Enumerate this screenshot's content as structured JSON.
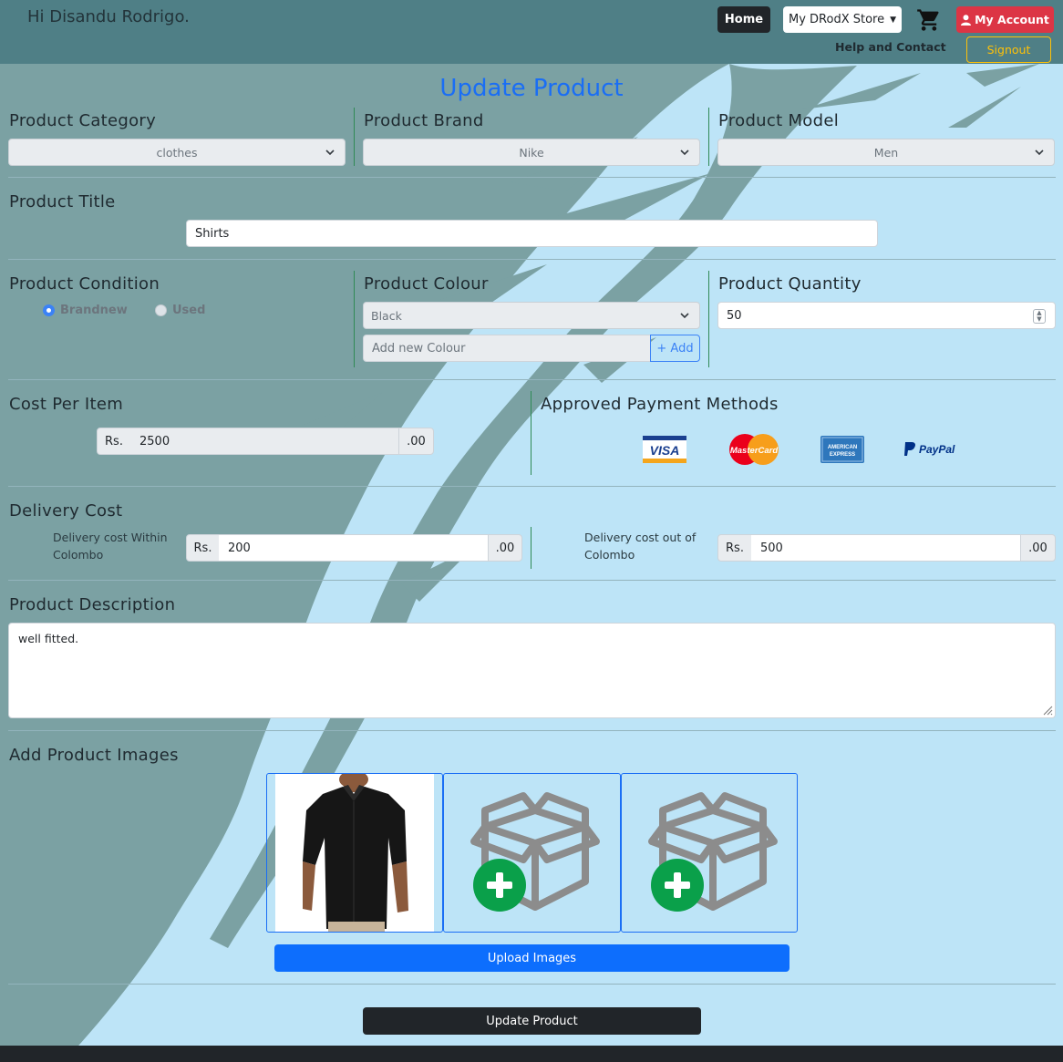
{
  "header": {
    "greeting": "Hi Disandu Rodrigo.",
    "home_label": "Home",
    "store_label": "My DRodX Store",
    "account_label": "My Account",
    "help_label": "Help and Contact",
    "signout_label": "Signout"
  },
  "page": {
    "title": "Update Product"
  },
  "category": {
    "label": "Product Category",
    "value": "clothes"
  },
  "brand": {
    "label": "Product Brand",
    "value": "Nike"
  },
  "model": {
    "label": "Product Model",
    "value": "Men"
  },
  "title_field": {
    "label": "Product Title",
    "value": "Shirts"
  },
  "condition": {
    "label": "Product Condition",
    "options": [
      "Brandnew",
      "Used"
    ],
    "selected": "Brandnew"
  },
  "colour": {
    "label": "Product Colour",
    "value": "Black",
    "new_placeholder": "Add new Colour",
    "add_label": "+ Add"
  },
  "quantity": {
    "label": "Product Quantity",
    "value": "50"
  },
  "cost": {
    "label": "Cost Per Item",
    "prefix": "Rs.",
    "value": "2500",
    "suffix": ".00"
  },
  "payment": {
    "label": "Approved Payment Methods",
    "methods": [
      "VISA",
      "MasterCard",
      "AMERICAN EXPRESS",
      "PayPal"
    ]
  },
  "delivery": {
    "label": "Delivery Cost",
    "within_label": "Delivery cost Within Colombo",
    "within_prefix": "Rs.",
    "within_value": "200",
    "within_suffix": ".00",
    "outside_label": "Delivery cost out of Colombo",
    "outside_prefix": "Rs.",
    "outside_value": "500",
    "outside_suffix": ".00"
  },
  "description": {
    "label": "Product Description",
    "value": "well fitted."
  },
  "images": {
    "label": "Add Product Images",
    "upload_label": "Upload Images"
  },
  "submit": {
    "label": "Update Product"
  },
  "colors": {
    "accent": "#1a6ef5",
    "topbar": "#4f7f86",
    "danger": "#dc3545",
    "warning": "#ffc107",
    "dark": "#212529",
    "success": "#0aa04a"
  }
}
